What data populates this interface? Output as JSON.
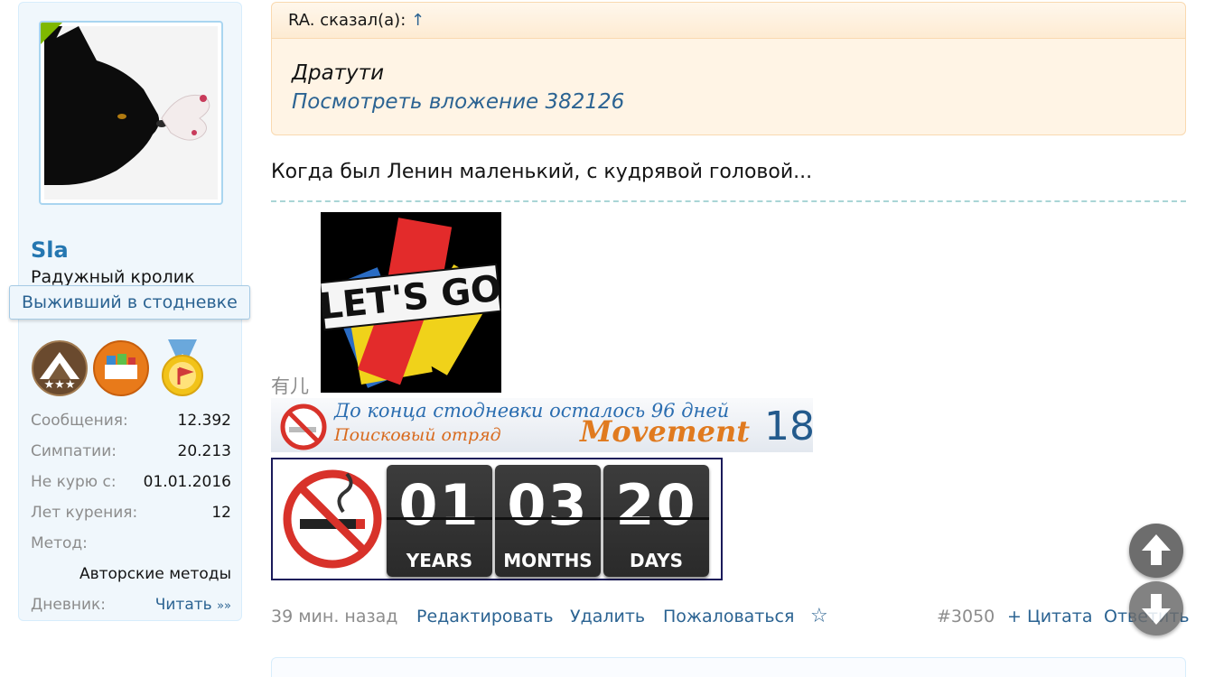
{
  "user": {
    "username": "Sla",
    "title": "Радужный кролик",
    "ribbon": "Выживший в стодневке",
    "trophy_icons": [
      "mountain-stars-icon",
      "books-icon",
      "medal-icon"
    ],
    "stats": [
      {
        "label": "Сообщения:",
        "value": "12.392"
      },
      {
        "label": "Симпатии:",
        "value": "20.213"
      },
      {
        "label": "Не курю с:",
        "value": "01.01.2016"
      },
      {
        "label": "Лет курения:",
        "value": "12"
      },
      {
        "label": "Метод:",
        "value": ""
      },
      {
        "label": "",
        "value": "Авторские методы"
      },
      {
        "label": "Дневник:",
        "value": "Читать",
        "arrow": "»»"
      }
    ]
  },
  "quote": {
    "author_line": "RA. сказал(а):",
    "arrow": "↑",
    "text": "Дратути",
    "attachment": "Посмотреть вложение 382126"
  },
  "message": {
    "text": "Когда был Ленин маленький, с кудрявой головой..."
  },
  "signature": {
    "letsgo_text": "LET'S GO",
    "char": "有儿",
    "movement_banner": {
      "line1": "До конца стодневки осталось 96 дней",
      "line2": "Поисковый отряд",
      "brand": "Movement",
      "number": "18"
    },
    "counter": [
      {
        "digits": "01",
        "unit": "YEARS"
      },
      {
        "digits": "03",
        "unit": "MONTHS"
      },
      {
        "digits": "20",
        "unit": "DAYS"
      }
    ]
  },
  "footer": {
    "time": "39 мин. назад",
    "edit": "Редактировать",
    "delete": "Удалить",
    "report": "Пожаловаться",
    "star": "☆",
    "post_number": "#3050",
    "quote": "+ Цитата",
    "reply": "Ответить"
  },
  "colors": {
    "link": "#2b6392",
    "username": "#2577b1",
    "quote_bg": "#fff4e5",
    "sidebar_bg": "#f0f7fc"
  }
}
